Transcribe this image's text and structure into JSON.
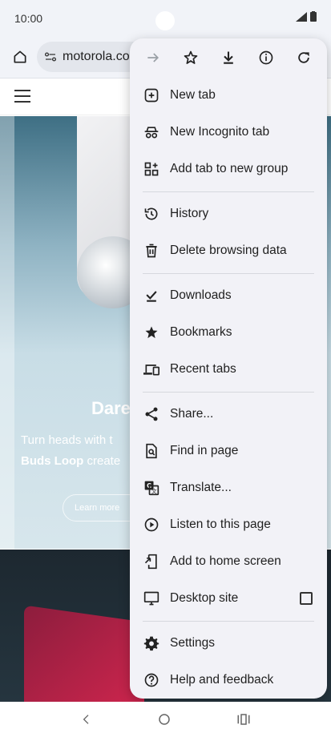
{
  "status": {
    "time": "10:00"
  },
  "toolbar": {
    "url": "motorola.com"
  },
  "hero": {
    "title": "Dare",
    "line1": "Turn heads with t",
    "line2_bold": "Buds Loop",
    "line2_rest": " create",
    "button": "Learn more"
  },
  "menu": {
    "items": [
      {
        "label": "New tab",
        "icon": "plus-box-icon"
      },
      {
        "label": "New Incognito tab",
        "icon": "incognito-icon"
      },
      {
        "label": "Add tab to new group",
        "icon": "tab-group-icon"
      },
      {
        "label": "History",
        "icon": "history-icon"
      },
      {
        "label": "Delete browsing data",
        "icon": "trash-icon"
      },
      {
        "label": "Downloads",
        "icon": "download-done-icon"
      },
      {
        "label": "Bookmarks",
        "icon": "star-filled-icon"
      },
      {
        "label": "Recent tabs",
        "icon": "devices-icon"
      },
      {
        "label": "Share...",
        "icon": "share-icon"
      },
      {
        "label": "Find in page",
        "icon": "find-in-page-icon"
      },
      {
        "label": "Translate...",
        "icon": "translate-icon"
      },
      {
        "label": "Listen to this page",
        "icon": "play-circle-icon"
      },
      {
        "label": "Add to home screen",
        "icon": "add-to-home-icon"
      },
      {
        "label": "Desktop site",
        "icon": "desktop-icon"
      },
      {
        "label": "Settings",
        "icon": "gear-icon"
      },
      {
        "label": "Help and feedback",
        "icon": "help-icon"
      }
    ]
  }
}
